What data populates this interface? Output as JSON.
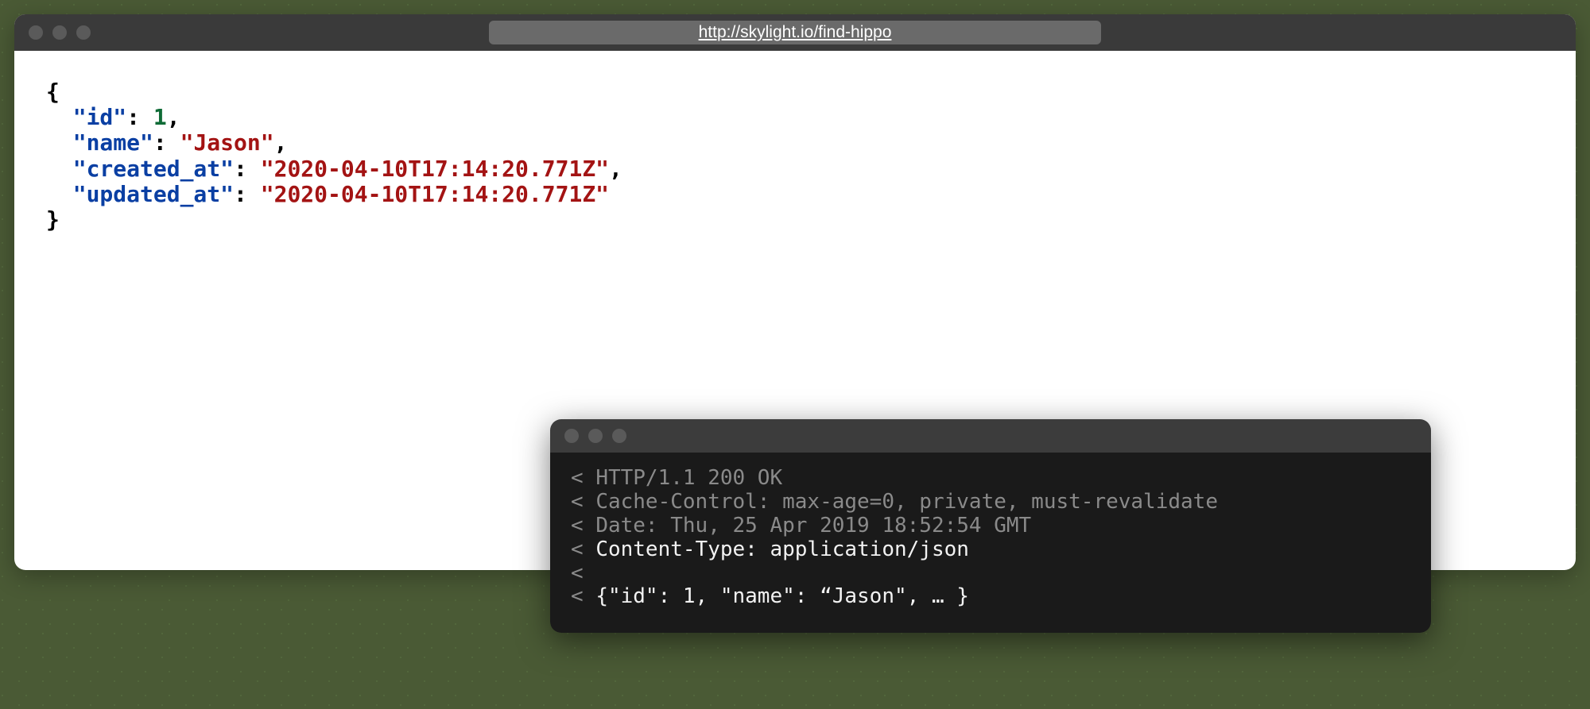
{
  "browser": {
    "url": "http://skylight.io/find-hippo",
    "json": {
      "keys": {
        "id": "\"id\"",
        "name": "\"name\"",
        "created_at": "\"created_at\"",
        "updated_at": "\"updated_at\""
      },
      "vals": {
        "id": "1",
        "name": "\"Jason\"",
        "created_at": "\"2020-04-10T17:14:20.771Z\"",
        "updated_at": "\"2020-04-10T17:14:20.771Z\""
      },
      "punct": {
        "open": "{",
        "close": "}",
        "colon": ": ",
        "comma": ","
      }
    }
  },
  "terminal": {
    "lines": {
      "l1_prefix": "< ",
      "l1": "HTTP/1.1 200 OK",
      "l2": "Cache-Control: max-age=0, private, must-revalidate",
      "l3": "Date: Thu, 25 Apr 2019 18:52:54 GMT",
      "l4": "Content-Type: application/json",
      "l5_prefix": "<",
      "l6": "{\"id\": 1, \"name\": “Jason\", … }"
    }
  }
}
